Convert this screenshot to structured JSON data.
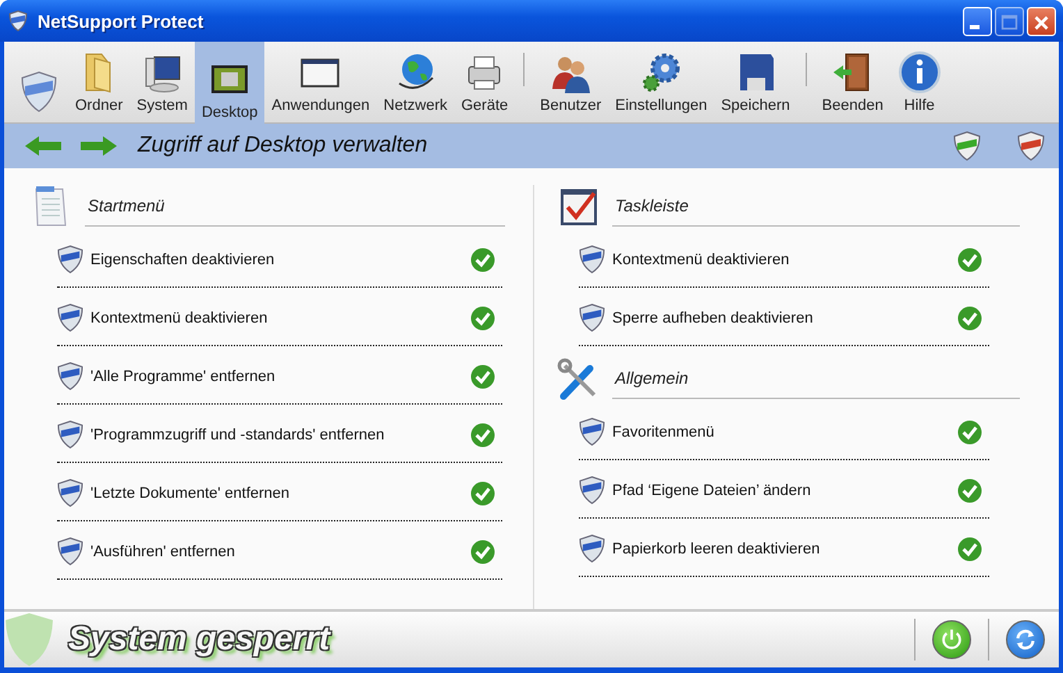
{
  "window": {
    "title": "NetSupport Protect"
  },
  "toolbar": {
    "groups": [
      [
        {
          "selected": false
        },
        {
          "label": "Ordner",
          "selected": false
        },
        {
          "label": "System",
          "selected": false
        },
        {
          "label": "Desktop",
          "selected": true
        },
        {
          "label": "Anwendungen",
          "selected": false
        },
        {
          "label": "Netzwerk",
          "selected": false
        },
        {
          "label": "Geräte",
          "selected": false
        }
      ],
      [
        {
          "label": "Benutzer",
          "selected": false
        },
        {
          "label": "Einstellungen",
          "selected": false
        },
        {
          "label": "Speichern",
          "selected": false
        }
      ],
      [
        {
          "label": "Beenden",
          "selected": false
        },
        {
          "label": "Hilfe",
          "selected": false
        }
      ]
    ]
  },
  "header": {
    "title": "Zugriff auf Desktop verwalten"
  },
  "columns": [
    [
      {
        "kind": "document",
        "title": "Startmenü",
        "items": [
          {
            "label": "Eigenschaften deaktivieren",
            "checked": true
          },
          {
            "label": "Kontextmenü deaktivieren",
            "checked": true
          },
          {
            "label": "'Alle Programme' entfernen",
            "checked": true
          },
          {
            "label": "'Programmzugriff und -standards' entfernen",
            "checked": true
          },
          {
            "label": "'Letzte Dokumente' entfernen",
            "checked": true
          },
          {
            "label": "'Ausführen' entfernen",
            "checked": true
          }
        ]
      }
    ],
    [
      {
        "kind": "taskbar",
        "title": "Taskleiste",
        "items": [
          {
            "label": "Kontextmenü deaktivieren",
            "checked": true
          },
          {
            "label": "Sperre aufheben deaktivieren",
            "checked": true
          }
        ]
      },
      {
        "kind": "tools",
        "title": "Allgemein",
        "items": [
          {
            "label": "Favoritenmenü",
            "checked": true
          },
          {
            "label": "Pfad ‘Eigene Dateien’ ändern",
            "checked": true
          },
          {
            "label": "Papierkorb leeren deaktivieren",
            "checked": true
          }
        ]
      }
    ]
  ],
  "status_bar": {
    "text": "System gesperrt"
  }
}
